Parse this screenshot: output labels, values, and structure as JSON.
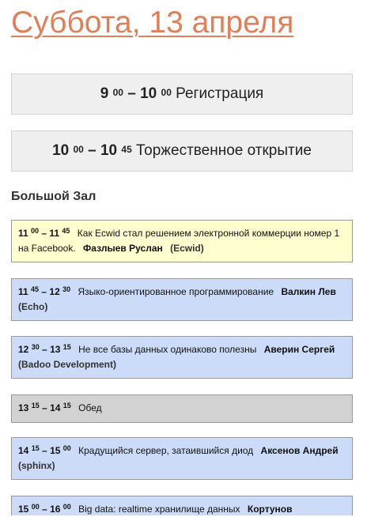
{
  "day_title": "Суббота, 13 апреля",
  "plenary": [
    {
      "start_h": "9",
      "start_m": "00",
      "end_h": "10",
      "end_m": "00",
      "title": "Регистрация"
    },
    {
      "start_h": "10",
      "start_m": "00",
      "end_h": "10",
      "end_m": "45",
      "title": "Торжественное открытие"
    }
  ],
  "hall_name": "Большой Зал",
  "slots": [
    {
      "start_h": "11",
      "start_m": "00",
      "end_h": "11",
      "end_m": "45",
      "title": "Как Ecwid стал решением электронной коммерции номер 1 на Facebook.",
      "speaker": "Фазлыев Руслан",
      "company": "(Ecwid)",
      "color": "#fefece"
    },
    {
      "start_h": "11",
      "start_m": "45",
      "end_h": "12",
      "end_m": "30",
      "title": "Языко-ориентированное программирование",
      "speaker": "Валкин Лев",
      "company": "(Echo)",
      "color": "#cbdbf8"
    },
    {
      "start_h": "12",
      "start_m": "30",
      "end_h": "13",
      "end_m": "15",
      "title": "Не все базы данных одинаково полезны",
      "speaker": "Аверин Сергей",
      "company": "(Badoo Development)",
      "color": "#cbdbf8"
    },
    {
      "start_h": "13",
      "start_m": "15",
      "end_h": "14",
      "end_m": "15",
      "title": "Обед",
      "speaker": "",
      "company": "",
      "color": "#d2d2d2"
    },
    {
      "start_h": "14",
      "start_m": "15",
      "end_h": "15",
      "end_m": "00",
      "title": "Крадущийся сервер, затаившийся диод",
      "speaker": "Аксенов Андрей",
      "company": "(sphinx)",
      "color": "#cbdbf8"
    },
    {
      "start_h": "15",
      "start_m": "00",
      "end_h": "16",
      "end_m": "00",
      "title": "Big data: realtime хранилище данных",
      "speaker": "Кортунов",
      "company": "",
      "color": "#cbdbf8"
    }
  ]
}
